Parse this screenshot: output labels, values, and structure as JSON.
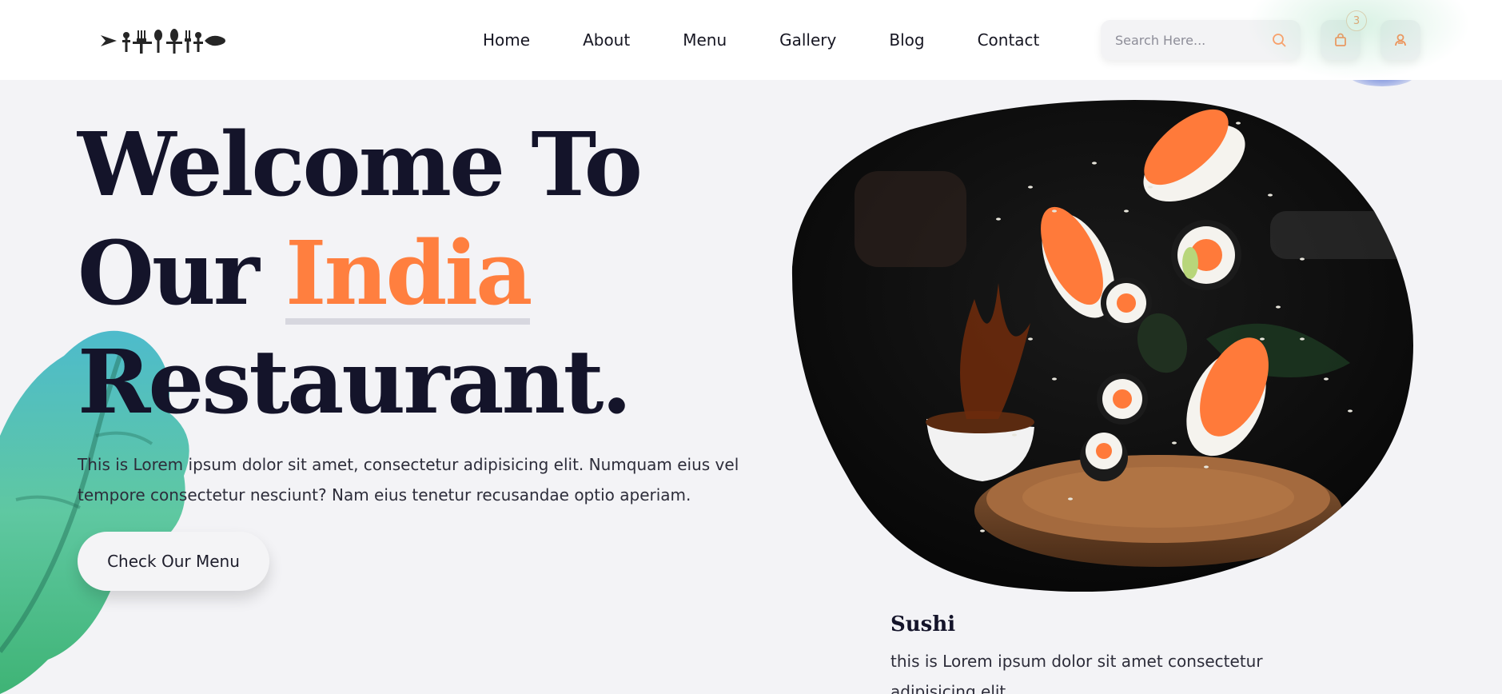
{
  "header": {
    "logo_icon": "utensils-fish-logo",
    "nav": [
      "Home",
      "About",
      "Menu",
      "Gallery",
      "Blog",
      "Contact"
    ],
    "search_placeholder": "Search Here...",
    "cart_count": "3",
    "icons": [
      "search-icon",
      "shopping-bag-icon",
      "user-icon"
    ]
  },
  "hero": {
    "title_line1": "Welcome To",
    "title_line2_prefix": "Our ",
    "title_line2_accent": "India",
    "title_line3": "Restaurant.",
    "description": "This is Lorem ipsum dolor sit amet, consectetur adipisicing elit. Numquam eius vel tempore consectetur nesciunt? Nam eius tenetur recusandae optio aperiam.",
    "cta_label": "Check Our Menu"
  },
  "featured": {
    "image": "flying-sushi-photo",
    "title": "Sushi",
    "description": "this is Lorem ipsum dolor sit amet consectetur adipisicing elit."
  },
  "colors": {
    "accent": "#ff7f3f",
    "heading": "#14142a",
    "background": "#f3f3f6",
    "header_bg": "#ffffff"
  }
}
